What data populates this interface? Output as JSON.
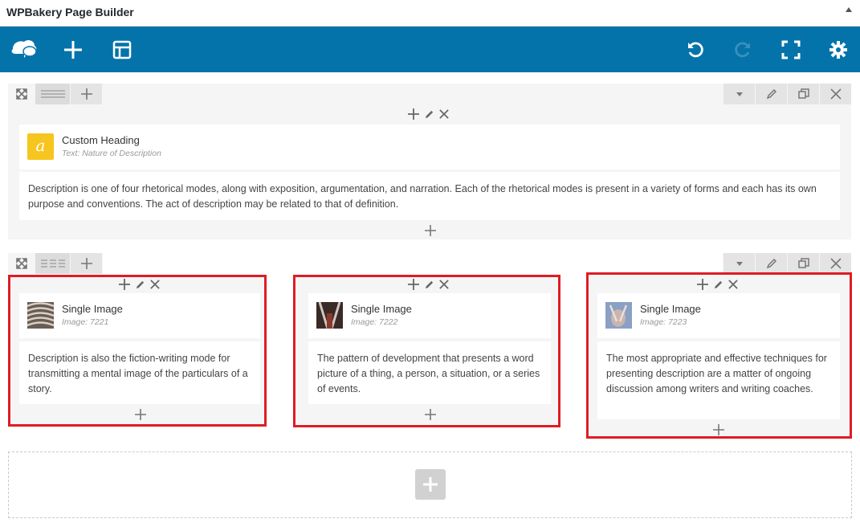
{
  "panel": {
    "title": "WPBakery Page Builder"
  },
  "toolbar": {
    "icons": [
      "logo-icon",
      "add-element-icon",
      "templates-icon",
      "undo-icon",
      "redo-icon",
      "fullscreen-icon",
      "settings-icon"
    ],
    "accent": "#0473aa"
  },
  "row1": {
    "heading": {
      "title": "Custom Heading",
      "subtitle": "Text: Nature of Description"
    },
    "text": "Description is one of four rhetorical modes, along with exposition, argumentation, and narration. Each of the rhetorical modes is present in a variety of forms and each has its own purpose and conventions. The act of description may be related to that of definition."
  },
  "row2": {
    "columns": [
      {
        "title": "Single Image",
        "subtitle": "Image: 7221",
        "text": "Description is also the fiction-writing mode for transmitting a mental image of the particulars of a story."
      },
      {
        "title": "Single Image",
        "subtitle": "Image: 7222",
        "text": "The pattern of development that presents a word picture of a thing, a person, a situation, or a series of events."
      },
      {
        "title": "Single Image",
        "subtitle": "Image: 7223",
        "text": "The most appropriate and effective techniques for presenting description are a matter of ongoing discussion among writers and writing coaches."
      }
    ]
  },
  "colors": {
    "highlight": "#e01b24",
    "heading_icon": "#f7c51f"
  }
}
